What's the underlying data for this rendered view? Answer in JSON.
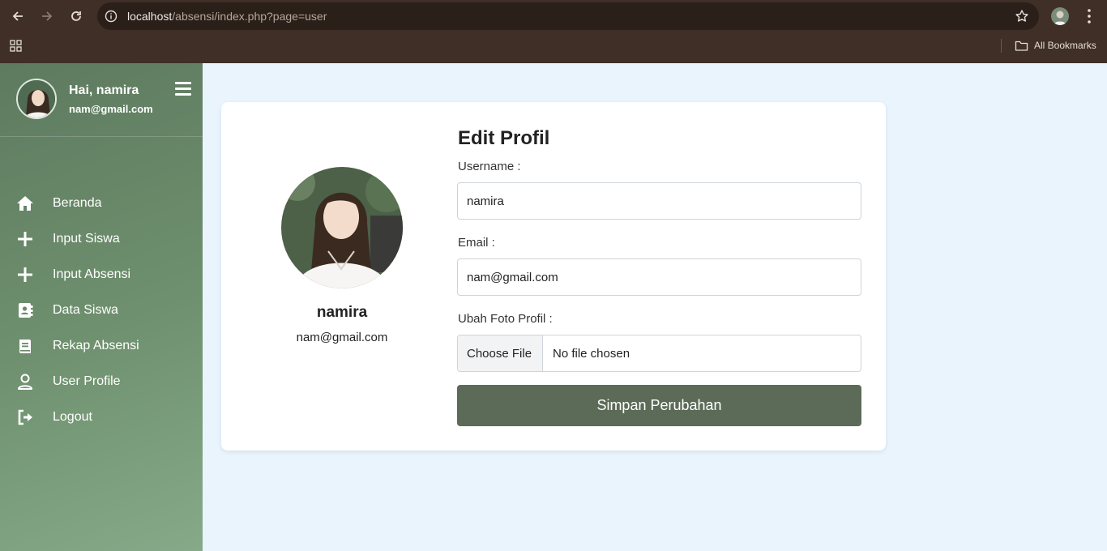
{
  "browser": {
    "url_host": "localhost",
    "url_path": "/absensi/index.php?page=user",
    "bookmarks_label": "All Bookmarks"
  },
  "sidebar": {
    "greeting": "Hai, namira",
    "email": "nam@gmail.com",
    "items": [
      {
        "label": "Beranda",
        "icon": "home-icon"
      },
      {
        "label": "Input Siswa",
        "icon": "plus-icon"
      },
      {
        "label": "Input Absensi",
        "icon": "plus-icon"
      },
      {
        "label": "Data Siswa",
        "icon": "address-book-icon"
      },
      {
        "label": "Rekap Absensi",
        "icon": "book-icon"
      },
      {
        "label": "User Profile",
        "icon": "user-icon"
      },
      {
        "label": "Logout",
        "icon": "logout-icon"
      }
    ]
  },
  "profile": {
    "name": "namira",
    "email": "nam@gmail.com"
  },
  "form": {
    "title": "Edit Profil",
    "username_label": "Username :",
    "username_value": "namira",
    "email_label": "Email :",
    "email_value": "nam@gmail.com",
    "photo_label": "Ubah Foto Profil :",
    "file_button": "Choose File",
    "file_status": "No file chosen",
    "submit_label": "Simpan Perubahan"
  },
  "colors": {
    "browser_frame": "#3f2f27",
    "sidebar_start": "#5e7a5f",
    "sidebar_end": "#86aa89",
    "page_bg": "#e9f4fd",
    "submit_bg": "#5c6b58"
  }
}
